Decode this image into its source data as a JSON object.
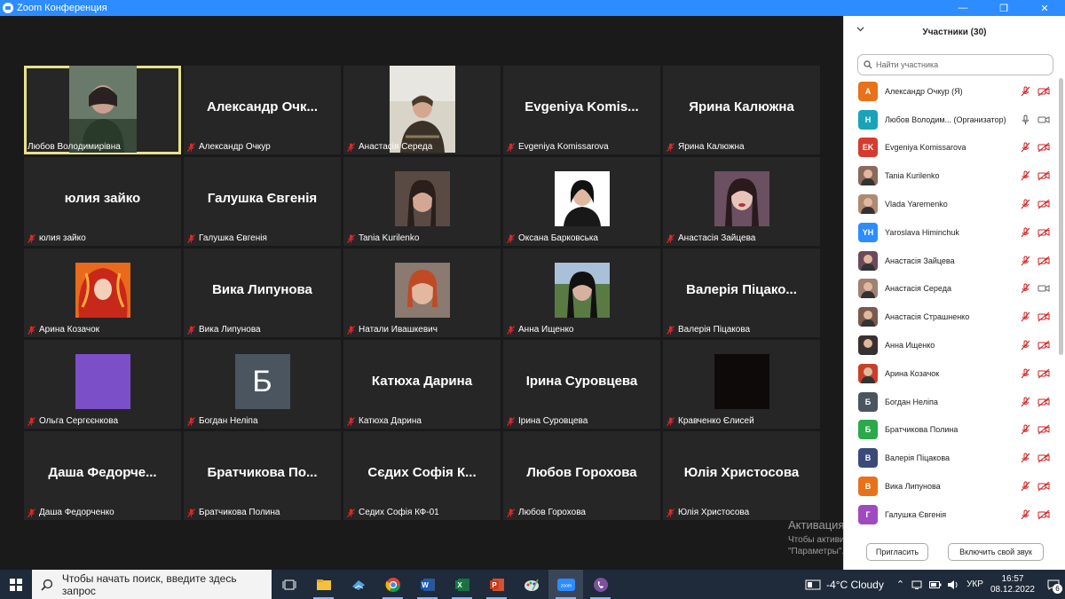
{
  "window": {
    "title": "Zoom Конференция"
  },
  "tiles": [
    {
      "caption": "Любов Володимирівна",
      "display": "",
      "kind": "photo",
      "active": true,
      "muted": false
    },
    {
      "caption": "Александр Очкур",
      "display": "Александр  Очк...",
      "kind": "name",
      "muted": true
    },
    {
      "caption": "Анастасія Середа",
      "display": "",
      "kind": "photo",
      "muted": true
    },
    {
      "caption": "Evgeniya Komissarova",
      "display": "Evgeniya  Komis...",
      "kind": "name",
      "muted": true
    },
    {
      "caption": "Ярина Калюжна",
      "display": "Ярина Калюжна",
      "kind": "name",
      "muted": true
    },
    {
      "caption": "юлия зайко",
      "display": "юлия зайко",
      "kind": "name",
      "muted": true
    },
    {
      "caption": "Галушка Євгенія",
      "display": "Галушка Євгенія",
      "kind": "name",
      "muted": true
    },
    {
      "caption": "Tania Kurilenko",
      "display": "",
      "kind": "photo",
      "muted": true
    },
    {
      "caption": "Оксана Барковська",
      "display": "",
      "kind": "photo",
      "muted": true
    },
    {
      "caption": "Анастасія Зайцева",
      "display": "",
      "kind": "photo",
      "muted": true
    },
    {
      "caption": "Арина Козачок",
      "display": "",
      "kind": "photo",
      "muted": true
    },
    {
      "caption": "Вика Липунова",
      "display": "Вика Липунова",
      "kind": "name",
      "muted": true
    },
    {
      "caption": "Натали Ивашкевич",
      "display": "",
      "kind": "photo",
      "muted": true
    },
    {
      "caption": "Анна Ищенко",
      "display": "",
      "kind": "photo",
      "muted": true
    },
    {
      "caption": "Валерія Піцакова",
      "display": "Валерія Піцако...",
      "kind": "name",
      "muted": true
    },
    {
      "caption": "Ольга Сергєєнкова",
      "display": "",
      "kind": "color",
      "muted": true
    },
    {
      "caption": "Богдан Неліпа",
      "display": "",
      "kind": "initial",
      "initial": "Б",
      "muted": true
    },
    {
      "caption": "Катюха Дарина",
      "display": "Катюха Дарина",
      "kind": "name",
      "muted": true
    },
    {
      "caption": "Ірина Суровцева",
      "display": "Ірина Суровцева",
      "kind": "name",
      "muted": true
    },
    {
      "caption": "Кравченко Єлисей",
      "display": "",
      "kind": "dark",
      "muted": true
    },
    {
      "caption": "Даша Федорченко",
      "display": "Даша  Федорче...",
      "kind": "name",
      "muted": true
    },
    {
      "caption": "Братчикова Полина",
      "display": "Братчикова  По...",
      "kind": "name",
      "muted": true
    },
    {
      "caption": "Седих Софія КФ-01",
      "display": "Сєдих  Софія  К...",
      "kind": "name",
      "muted": true
    },
    {
      "caption": "Любов Горохова",
      "display": "Любов Горохова",
      "kind": "name",
      "muted": true
    },
    {
      "caption": "Юлія Христосова",
      "display": "Юлія Христосова",
      "kind": "name",
      "muted": true
    }
  ],
  "panel": {
    "title": "Участники (30)",
    "search_placeholder": "Найти участника",
    "invite": "Пригласить",
    "unmute": "Включить свой звук",
    "participants": [
      {
        "name": "Александр Очкур (Я)",
        "avatar": "A",
        "color": "#e8711a",
        "mic": "off",
        "video": "off"
      },
      {
        "name": "Любов Володим... (Организатор)",
        "avatar": "Н",
        "color": "#1aa3b8",
        "mic": "on",
        "video": "on"
      },
      {
        "name": "Evgeniya Komissarova",
        "avatar": "EK",
        "color": "#d63b2f",
        "mic": "off",
        "video": "off"
      },
      {
        "name": "Tania Kurilenko",
        "avatar": "",
        "color": "#8a6a5a",
        "mic": "off",
        "video": "off"
      },
      {
        "name": "Vlada Yaremenko",
        "avatar": "",
        "color": "#b08a70",
        "mic": "off",
        "video": "off"
      },
      {
        "name": "Yaroslava Himinchuk",
        "avatar": "YH",
        "color": "#2d8cff",
        "mic": "off",
        "video": "off"
      },
      {
        "name": "Анастасія Зайцева",
        "avatar": "",
        "color": "#6a4a5a",
        "mic": "off",
        "video": "off"
      },
      {
        "name": "Анастасія Середа",
        "avatar": "",
        "color": "#a08070",
        "mic": "off",
        "video": "on"
      },
      {
        "name": "Анастасія Страшненко",
        "avatar": "",
        "color": "#7a5a4a",
        "mic": "off",
        "video": "off"
      },
      {
        "name": "Анна Ищенко",
        "avatar": "",
        "color": "#3a3030",
        "mic": "off",
        "video": "off"
      },
      {
        "name": "Арина Козачок",
        "avatar": "",
        "color": "#c8402a",
        "mic": "off",
        "video": "off"
      },
      {
        "name": "Богдан Неліпа",
        "avatar": "Б",
        "color": "#4a5560",
        "mic": "off",
        "video": "off"
      },
      {
        "name": "Братчикова Полина",
        "avatar": "Б",
        "color": "#2ba84a",
        "mic": "off",
        "video": "off"
      },
      {
        "name": "Валерія Піцакова",
        "avatar": "В",
        "color": "#3a4a7a",
        "mic": "off",
        "video": "off"
      },
      {
        "name": "Вика Липунова",
        "avatar": "В",
        "color": "#e8711a",
        "mic": "off",
        "video": "off"
      },
      {
        "name": "Галушка Євгенія",
        "avatar": "Г",
        "color": "#a04ac0",
        "mic": "off",
        "video": "off"
      }
    ]
  },
  "activation": {
    "line1": "Активация Windows",
    "line2": "Чтобы активировать Windows, перейдите в раздел",
    "line3": "\"Параметры\"."
  },
  "taskbar": {
    "search_text": "Чтобы начать поиск, введите здесь запрос",
    "weather": "-4°C  Cloudy",
    "lang": "УКР",
    "time": "16:57",
    "date": "08.12.2022",
    "notifications": "6"
  }
}
